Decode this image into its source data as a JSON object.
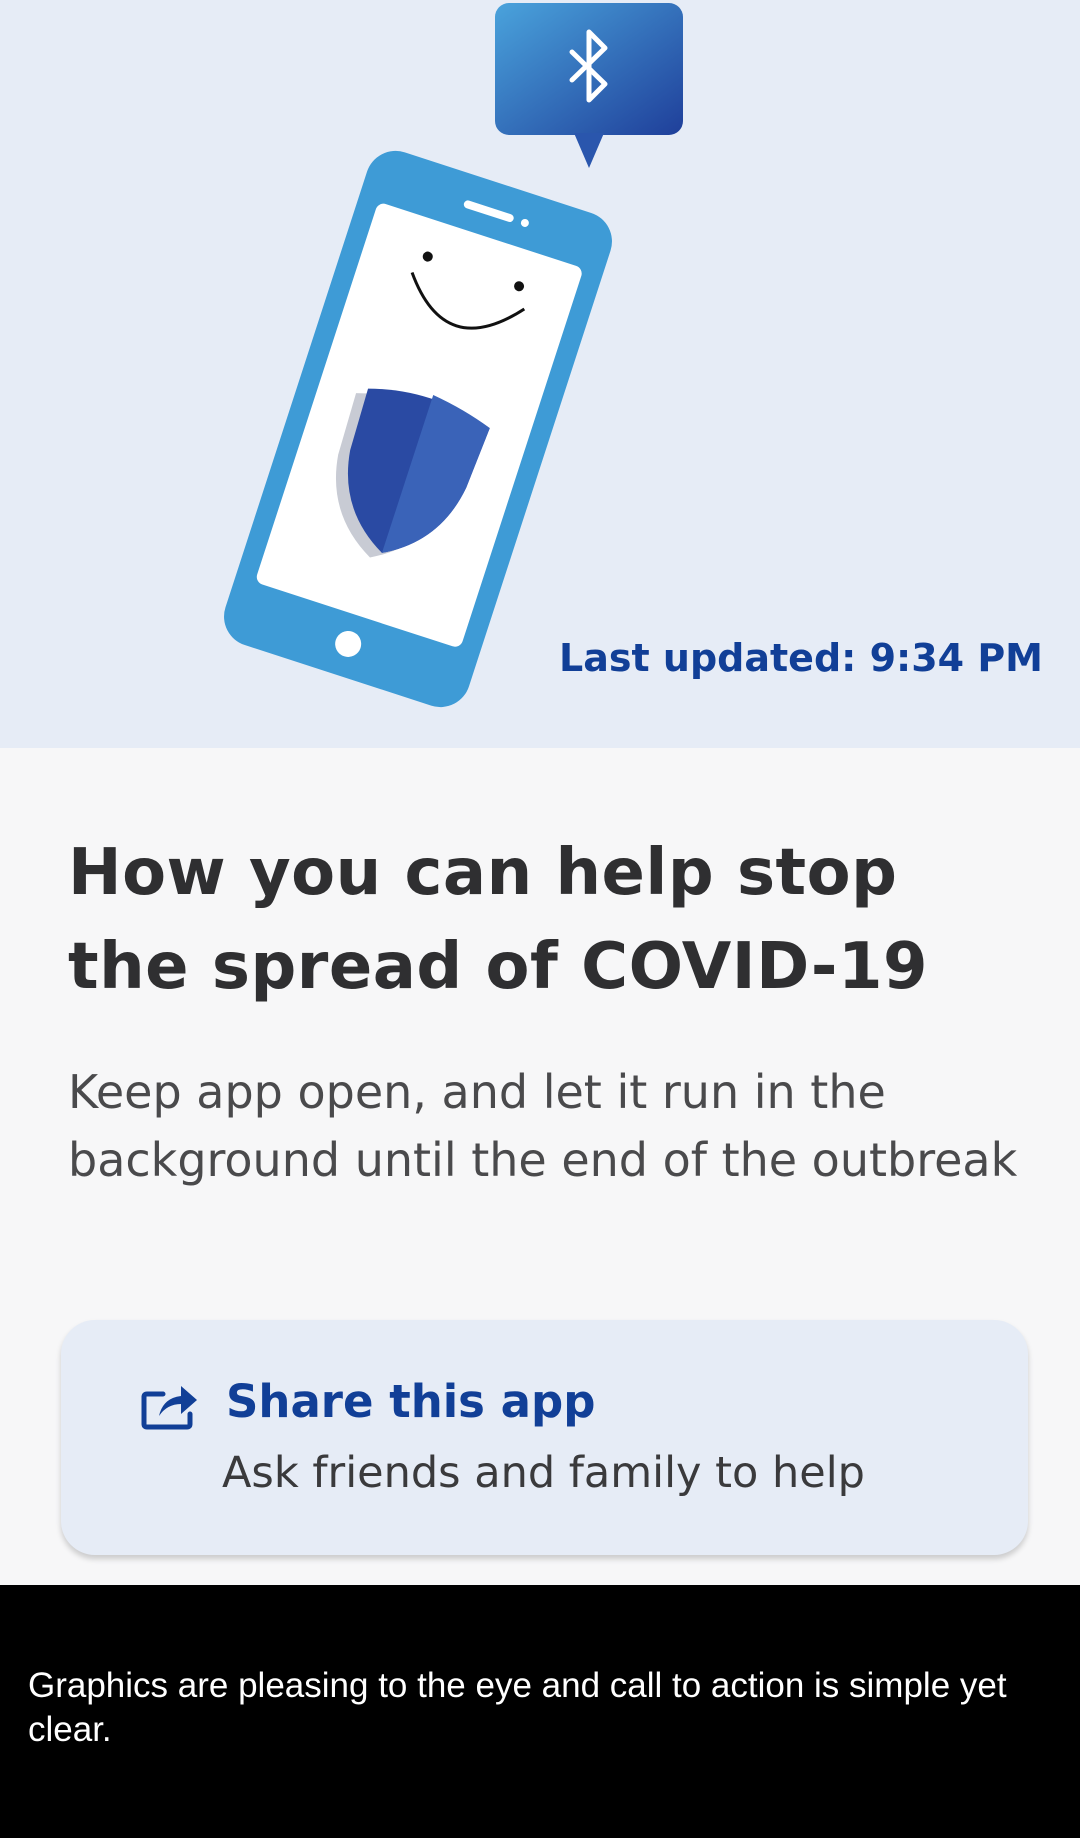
{
  "hero": {
    "last_updated": "Last updated: 9:34 PM",
    "illustration_icons": [
      "bluetooth-icon",
      "smiling-phone-illustration",
      "shield-icon"
    ],
    "colors": {
      "background": "#e6ecf6",
      "phone_frame": "#3e9bd6",
      "shield": "#2a4aa3",
      "bubble": "#2f6fc0"
    }
  },
  "main": {
    "headline": "How you can help stop the spread of COVID-19",
    "subtext": "Keep app open, and let it run in the background until the end of the outbreak"
  },
  "share_card": {
    "icon": "share-icon",
    "title": "Share this app",
    "subtitle": "Ask friends and family to help"
  },
  "caption": {
    "text": "Graphics are pleasing to the eye and call to action is simple yet clear."
  },
  "colors": {
    "accent": "#113f97",
    "page_background": "#f7f7f8",
    "caption_background": "#000000"
  }
}
